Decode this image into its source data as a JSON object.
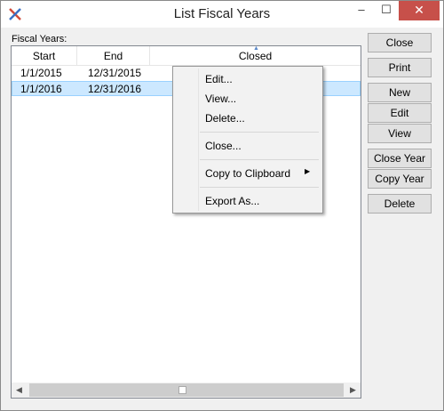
{
  "window": {
    "title": "List Fiscal Years",
    "min_glyph": "–",
    "max_glyph": "☐",
    "close_glyph": "✕"
  },
  "list": {
    "label": "Fiscal Years:",
    "columns": [
      "Start",
      "End",
      "Closed"
    ],
    "sort_indicator": "▲",
    "rows": [
      {
        "start": "1/1/2015",
        "end": "12/31/2015",
        "closed": ""
      },
      {
        "start": "1/1/2016",
        "end": "12/31/2016",
        "closed": ""
      }
    ],
    "scroll_left": "◀",
    "scroll_right": "▶"
  },
  "buttons": {
    "close": "Close",
    "print": "Print",
    "new": "New",
    "edit": "Edit",
    "view": "View",
    "close_year": "Close Year",
    "copy_year": "Copy Year",
    "delete": "Delete"
  },
  "context_menu": {
    "edit": "Edit...",
    "view": "View...",
    "delete": "Delete...",
    "close": "Close...",
    "copy_to_clipboard": "Copy to Clipboard",
    "submenu_arrow": "▶",
    "export_as": "Export As..."
  },
  "colors": {
    "selection": "#cce8ff",
    "close_button": "#c7504a"
  }
}
